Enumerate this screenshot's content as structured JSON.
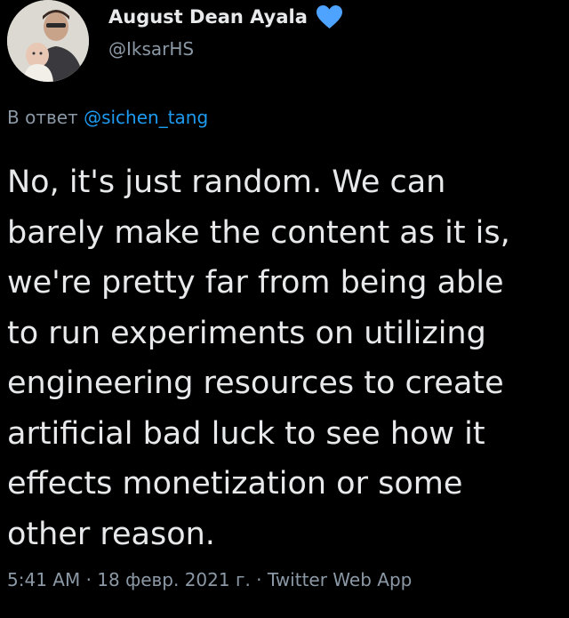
{
  "author": {
    "display_name": "August Dean Ayala",
    "handle": "@IksarHS",
    "badge_icon": "blue-heart-icon",
    "badge_color": "#4da3ff"
  },
  "reply": {
    "prefix": "В ответ",
    "mention": "@sichen_tang"
  },
  "tweet": {
    "text": "No, it's just random. We can\nbarely make the content as it is,\nwe're pretty far from being able\nto run experiments on utilizing\nengineering resources to create\nartificial bad luck to see how it\neffects monetization or some\nother reason."
  },
  "meta": {
    "time": "5:41 AM",
    "separator1": " · ",
    "date": "18 февр. 2021 г.",
    "separator2": " · ",
    "source": "Twitter Web App"
  },
  "colors": {
    "background": "#000000",
    "text": "#e7e9ea",
    "secondary": "#8b98a5",
    "link": "#1d9bf0"
  }
}
